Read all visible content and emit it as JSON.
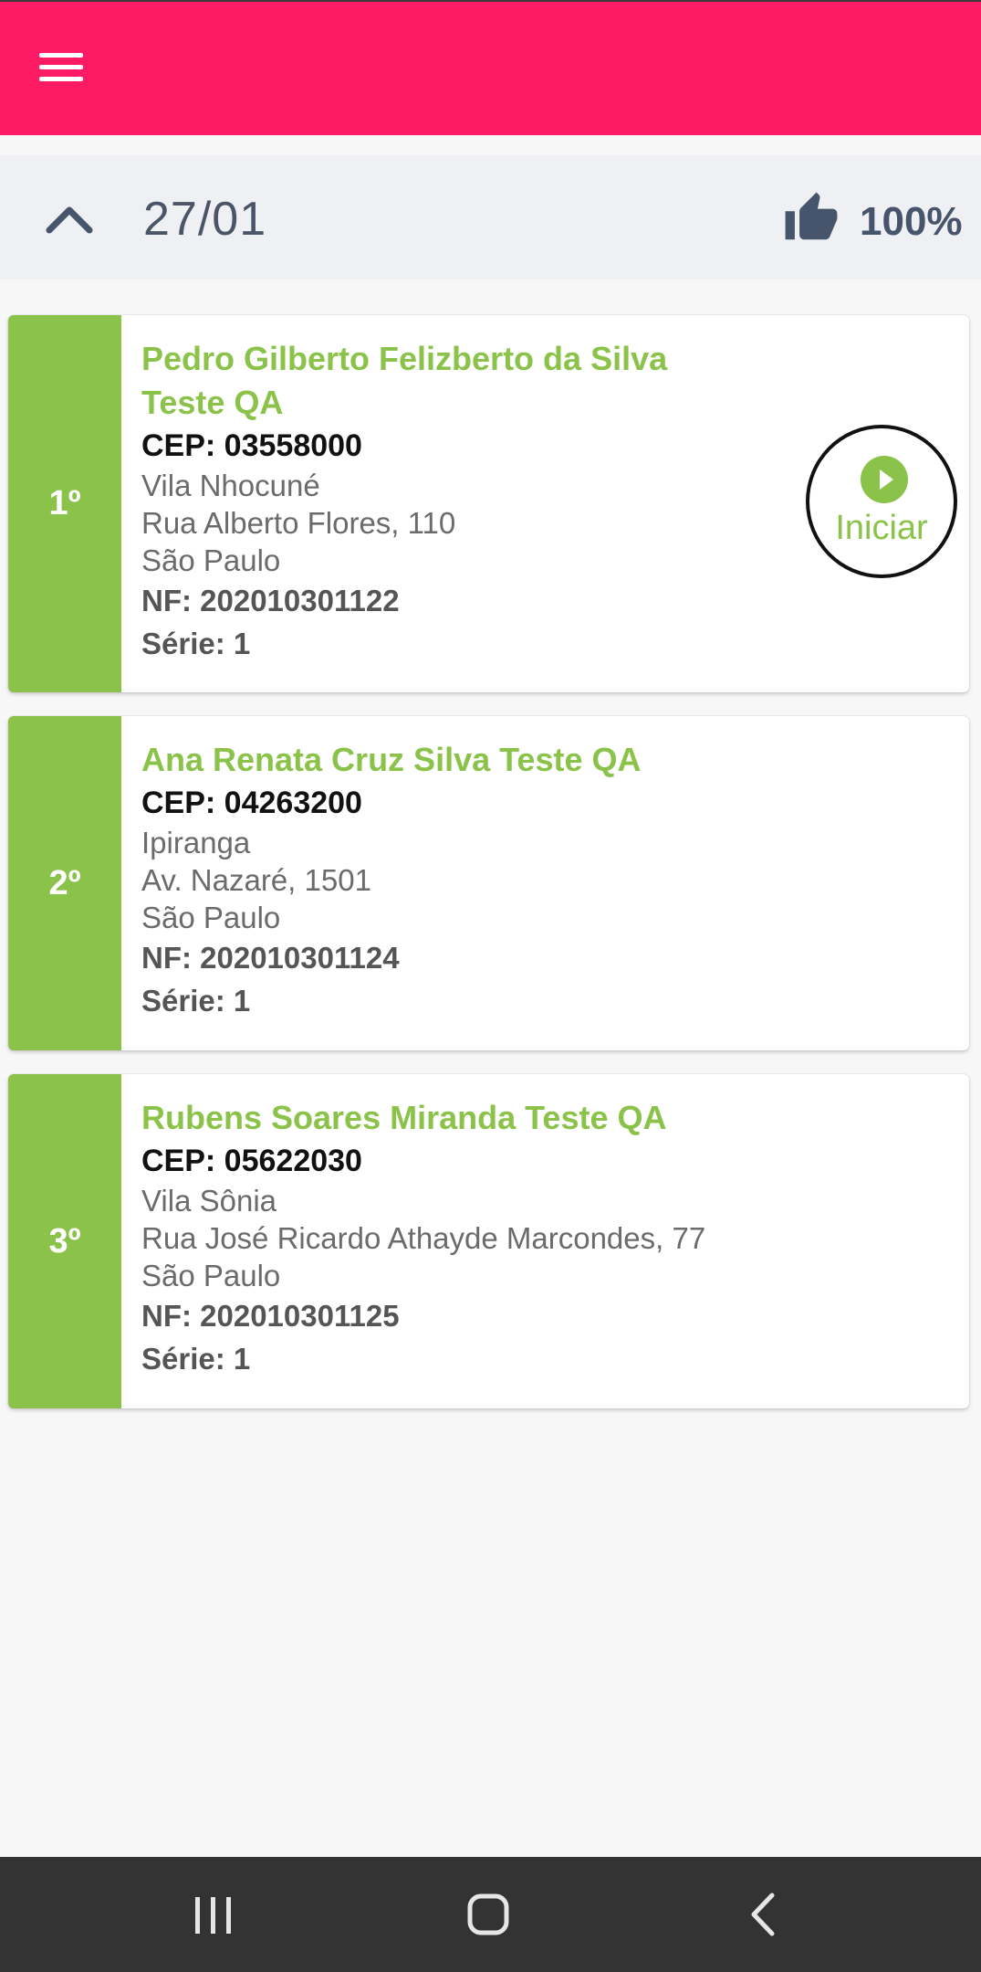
{
  "header": {
    "menu_icon": "hamburger-menu-icon",
    "color": "#fc1b64"
  },
  "date_bar": {
    "date": "27/01",
    "percent": "100%",
    "collapse_icon": "chevron-up-icon",
    "rating_icon": "thumbs-up-icon"
  },
  "accent_color": "#8bc34a",
  "deliveries": [
    {
      "order": "1º",
      "name": "Pedro Gilberto Felizberto da Silva Teste QA",
      "cep": "CEP: 03558000",
      "neighborhood": "Vila Nhocuné",
      "street": "Rua Alberto Flores, 110",
      "city": "São Paulo",
      "nf": "NF: 202010301122",
      "serie": "Série: 1",
      "action_label": "Iniciar"
    },
    {
      "order": "2º",
      "name": "Ana Renata Cruz Silva Teste QA",
      "cep": "CEP: 04263200",
      "neighborhood": "Ipiranga",
      "street": "Av. Nazaré, 1501",
      "city": "São Paulo",
      "nf": "NF: 202010301124",
      "serie": "Série: 1"
    },
    {
      "order": "3º",
      "name": "Rubens Soares Miranda Teste QA",
      "cep": "CEP: 05622030",
      "neighborhood": "Vila Sônia",
      "street": "Rua José Ricardo Athayde Marcondes, 77",
      "city": "São Paulo",
      "nf": "NF: 202010301125",
      "serie": "Série: 1"
    }
  ],
  "system_nav": {
    "icons": [
      "recent-apps-icon",
      "home-icon",
      "back-icon"
    ]
  }
}
